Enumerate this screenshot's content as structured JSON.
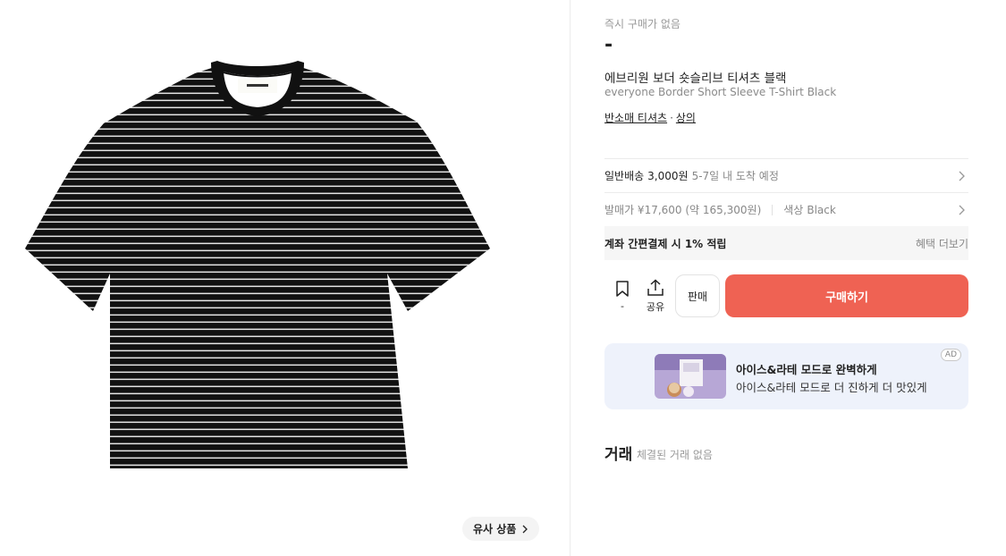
{
  "product": {
    "instant_label": "즉시 구매가 없음",
    "price": "-",
    "name_ko": "에브리원 보더 숏슬리브 티셔츠 블랙",
    "name_en": "everyone Border Short Sleeve T-Shirt Black",
    "category_1": "반소매 티셔츠",
    "category_sep": "·",
    "category_2": "상의"
  },
  "left": {
    "similar_label": "유사 상품"
  },
  "shipping": {
    "prefix": "일반배송",
    "fee": "3,000원",
    "eta": "5-7일 내 도착 예정"
  },
  "release": {
    "price": "발매가 ¥17,600 (약 165,300원)",
    "color_label": "색상",
    "color_value": "Black"
  },
  "benefit": {
    "label": "계좌 간편결제 시 1% 적립",
    "more": "혜택 더보기"
  },
  "actions": {
    "bookmark_count": "-",
    "share_label": "공유",
    "sell_label": "판매",
    "buy_label": "구매하기"
  },
  "ad": {
    "title": "아이스&라테 모드로 완벽하게",
    "subtitle": "아이스&라테 모드로 더 진하게 더 맛있게",
    "badge": "AD"
  },
  "trade": {
    "title": "거래",
    "empty": "체결된 거래 없음"
  },
  "colors": {
    "buy": "#ef6253",
    "ad_bg": "#eef2fb"
  }
}
